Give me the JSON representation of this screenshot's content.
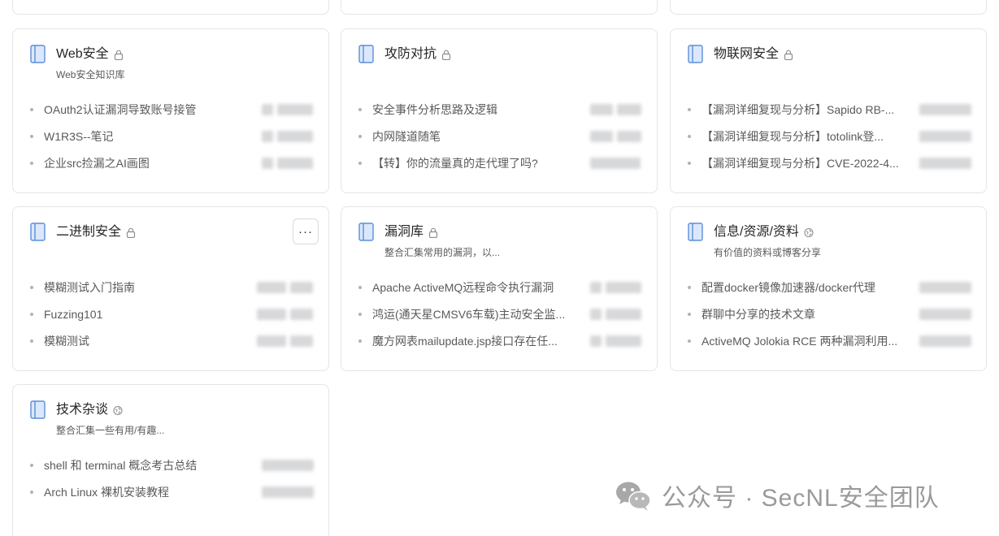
{
  "accent_color": "#5a8fd8",
  "cards": [
    {
      "title": "Web安全",
      "visibility": "lock-icon",
      "description": "Web安全知识库",
      "docs": [
        {
          "title": "OAuth2认证漏洞导致账号接管"
        },
        {
          "title": "W1R3S--笔记"
        },
        {
          "title": "企业src捡漏之AI画图"
        }
      ]
    },
    {
      "title": "攻防对抗",
      "visibility": "lock-icon",
      "description": "",
      "docs": [
        {
          "title": "安全事件分析思路及逻辑"
        },
        {
          "title": "内网隧道随笔"
        },
        {
          "title": "【转】你的流量真的走代理了吗?"
        }
      ]
    },
    {
      "title": "物联网安全",
      "visibility": "lock-icon",
      "description": "",
      "docs": [
        {
          "title": "【漏洞详细复现与分析】Sapido RB-..."
        },
        {
          "title": "【漏洞详细复现与分析】totolink登..."
        },
        {
          "title": "【漏洞详细复现与分析】CVE-2022-4..."
        }
      ]
    },
    {
      "title": "二进制安全",
      "visibility": "lock-icon",
      "description": "",
      "more_label": "···",
      "docs": [
        {
          "title": "模糊测试入门指南"
        },
        {
          "title": "Fuzzing101"
        },
        {
          "title": "模糊测试"
        }
      ]
    },
    {
      "title": "漏洞库",
      "visibility": "lock-icon",
      "description": "整合汇集常用的漏洞，以...",
      "docs": [
        {
          "title": "Apache ActiveMQ远程命令执行漏洞"
        },
        {
          "title": "鸿运(通天星CMSV6车载)主动安全监..."
        },
        {
          "title": "魔方网表mailupdate.jsp接口存在任..."
        }
      ]
    },
    {
      "title": "信息/资源/资料",
      "visibility": "public-icon",
      "description": "有价值的资料或博客分享",
      "docs": [
        {
          "title": "配置docker镜像加速器/docker代理"
        },
        {
          "title": "群聊中分享的技术文章"
        },
        {
          "title": "ActiveMQ Jolokia RCE 两种漏洞利用..."
        }
      ]
    },
    {
      "title": "技术杂谈",
      "visibility": "public-icon",
      "description": "整合汇集一些有用/有趣...",
      "docs": [
        {
          "title": "shell 和 terminal 概念考古总结"
        },
        {
          "title": "Arch Linux 裸机安装教程"
        }
      ]
    }
  ],
  "watermark": {
    "text": "公众号 · SecNL安全团队",
    "icon": "wechat-icon"
  }
}
